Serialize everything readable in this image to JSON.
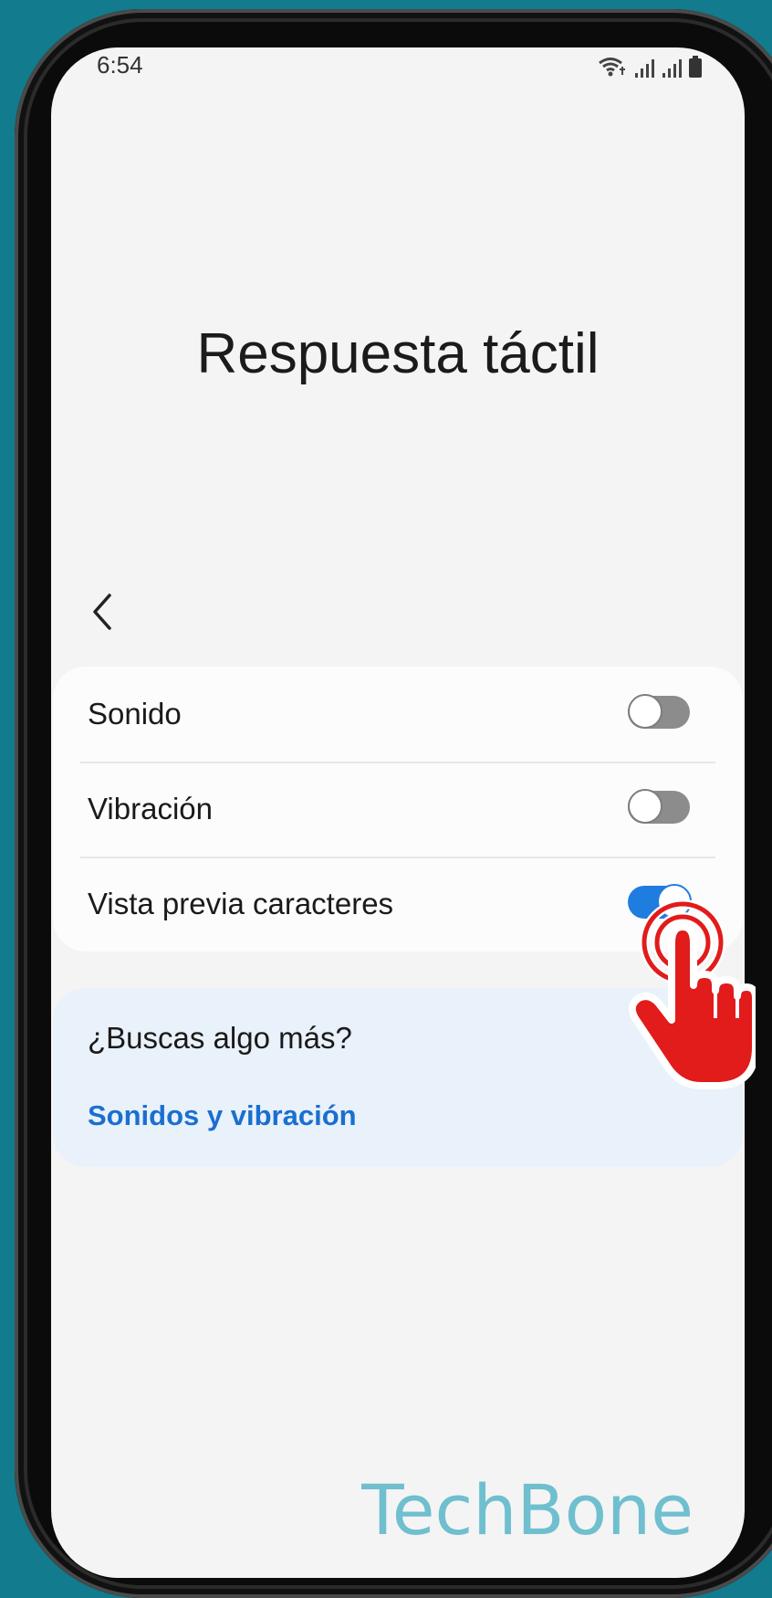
{
  "status_bar": {
    "time": "6:54"
  },
  "page": {
    "title": "Respuesta táctil"
  },
  "settings": [
    {
      "label": "Sonido",
      "enabled": false
    },
    {
      "label": "Vibración",
      "enabled": false
    },
    {
      "label": "Vista previa caracteres",
      "enabled": true
    }
  ],
  "more": {
    "title": "¿Buscas algo más?",
    "link": "Sonidos y vibración"
  },
  "watermark": "TechBone",
  "colors": {
    "background": "#127b8d",
    "toggle_on": "#1f7de0",
    "link": "#1a6fd1",
    "tap_indicator": "#e21b1b"
  }
}
